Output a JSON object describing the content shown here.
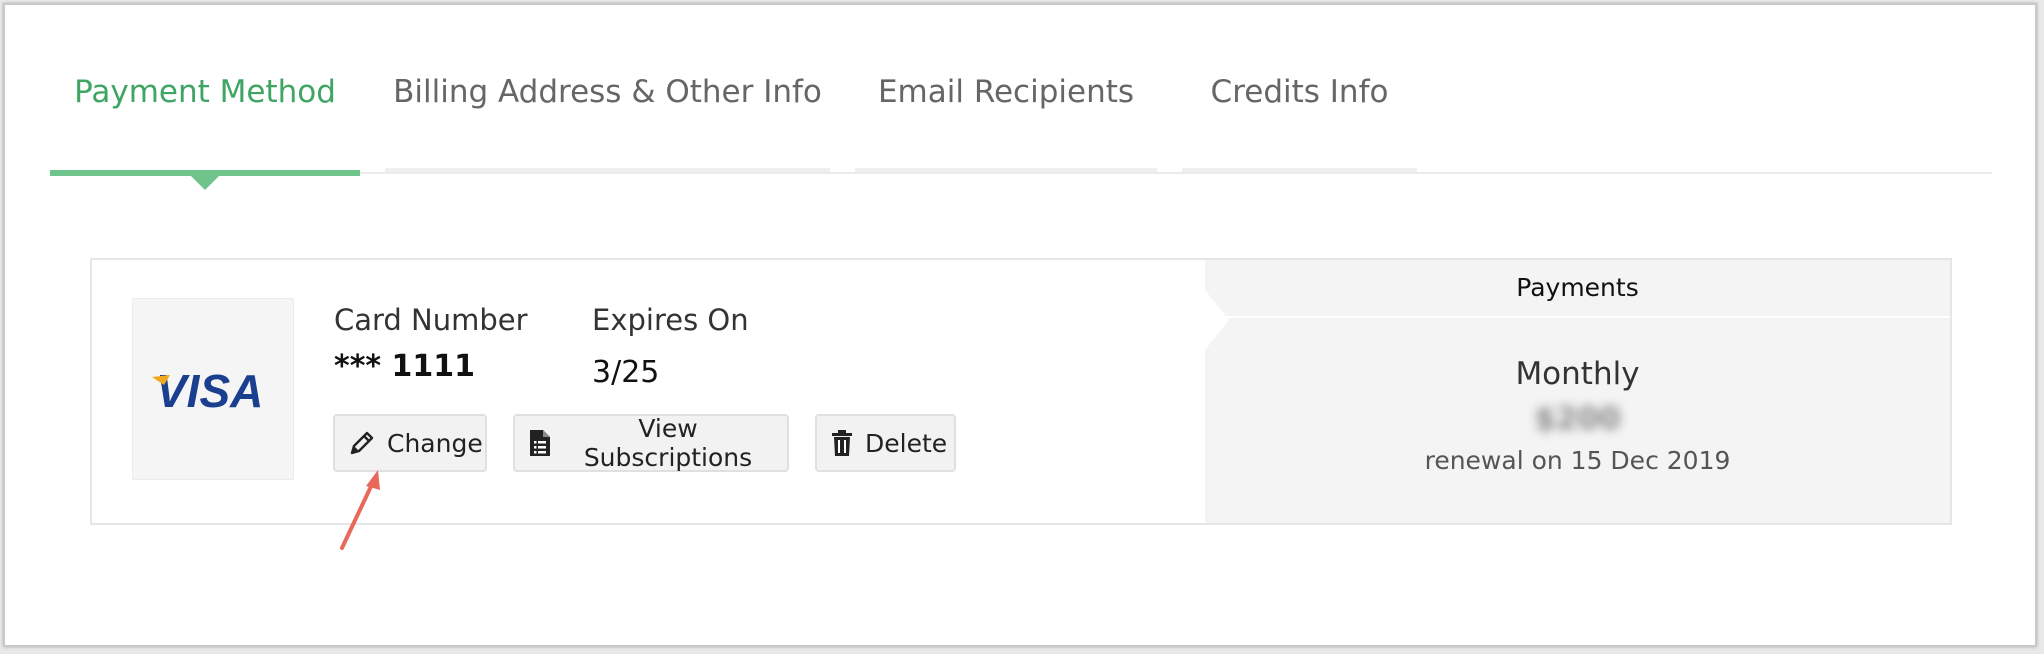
{
  "tabs": [
    {
      "label": "Payment Method",
      "active": true
    },
    {
      "label": "Billing Address & Other Info",
      "active": false
    },
    {
      "label": "Email Recipients",
      "active": false
    },
    {
      "label": "Credits Info",
      "active": false
    }
  ],
  "card": {
    "brand": "VISA",
    "number_label": "Card Number",
    "number_value": "*** 1111",
    "expires_label": "Expires On",
    "expires_value": "3/25"
  },
  "actions": {
    "change": "Change",
    "view_subscriptions": "View Subscriptions",
    "delete": "Delete"
  },
  "payments": {
    "title": "Payments",
    "frequency": "Monthly",
    "amount": "$200",
    "renewal": "renewal on 15 Dec 2019"
  },
  "colors": {
    "accent": "#3fa563",
    "tab_bar": "#6fc48c",
    "annotation_arrow": "#e8685a",
    "visa_blue": "#1a3f8f",
    "visa_gold": "#f2a81d"
  },
  "icons": {
    "change": "pencil-icon",
    "view_subscriptions": "document-icon",
    "delete": "trash-icon"
  }
}
